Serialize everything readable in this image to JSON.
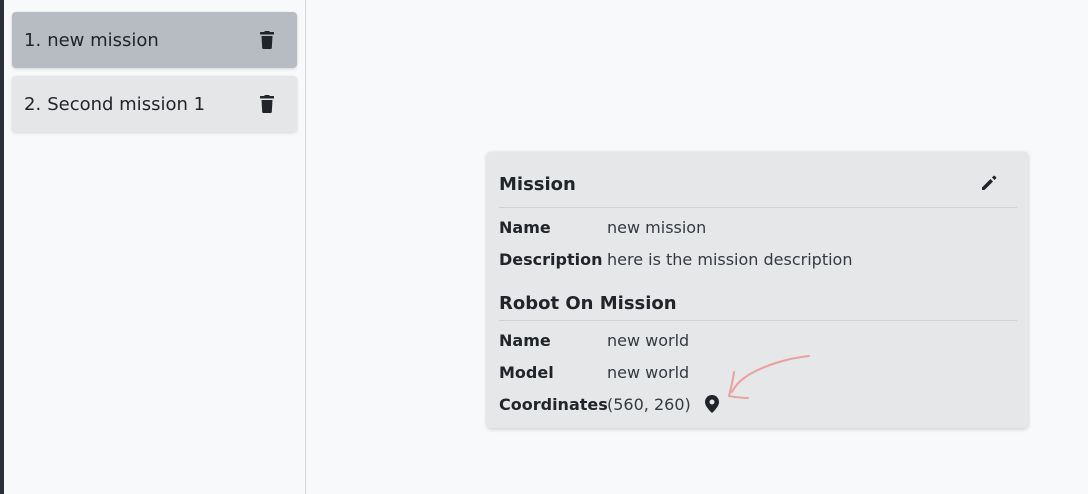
{
  "sidebar": {
    "missions": [
      {
        "number": "1.",
        "name": "new mission",
        "active": true
      },
      {
        "number": "2.",
        "name": "Second mission 1",
        "active": false
      }
    ]
  },
  "mission_card": {
    "mission_title": "Mission",
    "name_label": "Name",
    "name_value": "new mission",
    "description_label": "Description",
    "description_value": "here is the mission description",
    "robot_title": "Robot On Mission",
    "robot_name_label": "Name",
    "robot_name_value": "new world",
    "model_label": "Model",
    "model_value": "new world",
    "coordinates_label": "Coordinates",
    "coordinates_value": "(560, 260)"
  },
  "colors": {
    "active_item": "#b7bbc2",
    "inactive_item": "#e5e6e8",
    "card_bg": "#e6e7e9",
    "annotation_arrow": "#e8a0a0"
  },
  "icons": {
    "delete": "trash-icon",
    "edit": "pencil-icon",
    "location": "map-pin-icon"
  }
}
